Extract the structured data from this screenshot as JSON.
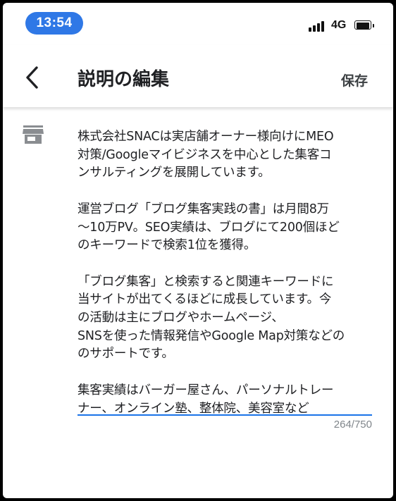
{
  "status_bar": {
    "time": "13:54",
    "network": "4G"
  },
  "app_bar": {
    "title": "説明の編集",
    "save_label": "保存"
  },
  "description": {
    "lines": [
      "株式会社SNACは実店舗オーナー様向けにMEO",
      "対策/Googleマイビジネスを中心とした集客コ",
      "ンサルティングを展開しています。",
      "",
      "運営ブログ「ブログ集客実践の書」は月間8万",
      "〜10万PV。SEO実績は、ブログにて200個ほど",
      "のキーワードで検索1位を獲得。",
      "",
      "「ブログ集客」と検索すると関連キーワードに",
      "当サイトが出てくるほどに成長しています。今",
      "の活動は主にブログやホームページ、",
      "SNSを使った情報発信やGoogle Map対策などの",
      "のサポートです。",
      "",
      "集客実績はバーガー屋さん、パーソナルトレー",
      "ナー、オンライン塾、整体院、美容室など"
    ],
    "char_count": "264/750"
  },
  "icons": {
    "back": "arrow-back-icon",
    "store": "store-icon",
    "signal": "cellular-signal-icon",
    "battery": "battery-icon"
  },
  "colors": {
    "accent": "#1a73e8",
    "time_pill": "#2f78e6",
    "counter": "#80868b",
    "icon_gray": "#8a8d91"
  }
}
